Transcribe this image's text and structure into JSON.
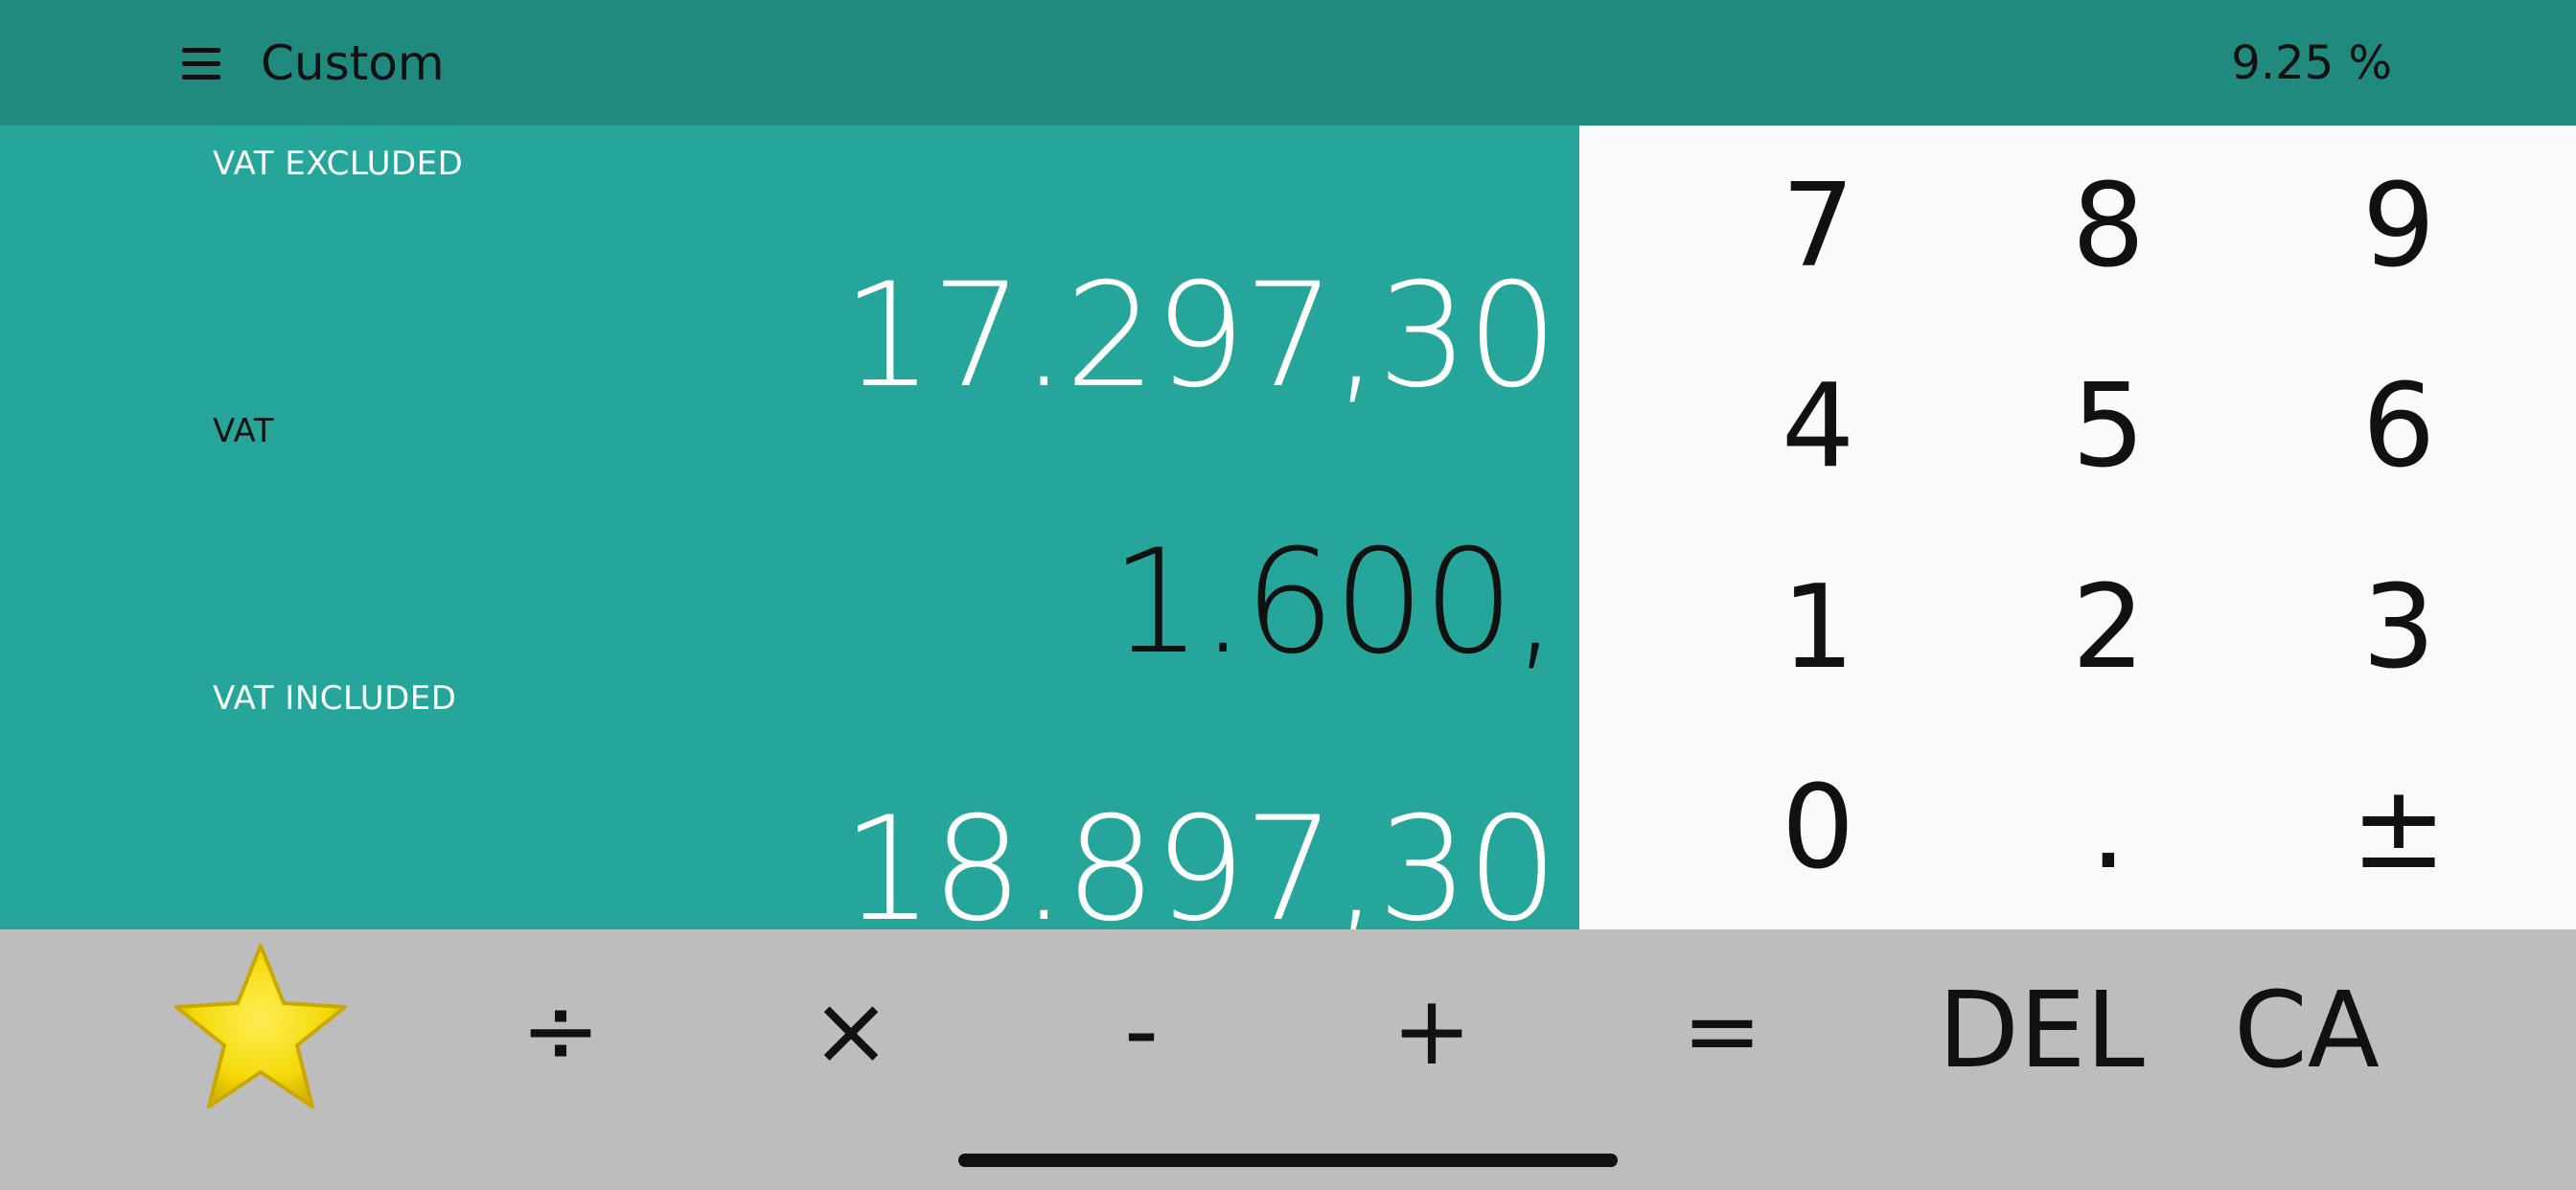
{
  "header": {
    "menu_icon": "hamburger-menu-icon",
    "title": "Custom",
    "rate": "9.25 %"
  },
  "results": {
    "vat_excluded_label": "VAT EXCLUDED",
    "vat_excluded_value": "17.297,30",
    "vat_label": "VAT",
    "vat_value": "1.600,",
    "vat_included_label": "VAT INCLUDED",
    "vat_included_value": "18.897,30"
  },
  "keypad": {
    "k7": "7",
    "k8": "8",
    "k9": "9",
    "k4": "4",
    "k5": "5",
    "k6": "6",
    "k1": "1",
    "k2": "2",
    "k3": "3",
    "k0": "0",
    "dot": ".",
    "plusminus": "±"
  },
  "toolbar": {
    "favorite_icon": "star-icon",
    "divide": "÷",
    "multiply": "×",
    "minus": "-",
    "plus": "+",
    "equals": "=",
    "delete": "DEL",
    "clear_all": "CA"
  },
  "colors": {
    "header": "#1f8a7d",
    "results_panel": "#26a69a",
    "keypad": "#fafafa",
    "toolbar": "#bdbdbd",
    "star": "#f5d90a"
  }
}
